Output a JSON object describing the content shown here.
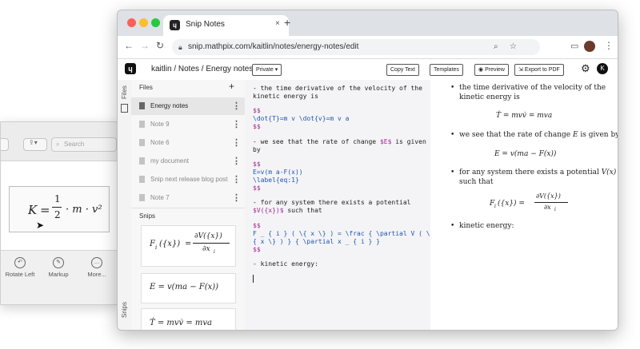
{
  "preview_app": {
    "search_placeholder": "Search",
    "equation": {
      "lhs": "K",
      "eq": "=",
      "num": "1",
      "den": "2",
      "rest": "· m · v²"
    },
    "toolbar": [
      {
        "label": "Rotate Left",
        "icon": "rotate-left-icon"
      },
      {
        "label": "Markup",
        "icon": "markup-icon"
      },
      {
        "label": "More...",
        "icon": "more-icon"
      }
    ]
  },
  "browser": {
    "tab_title": "Snip Notes",
    "new_tab": "+",
    "url": "snip.mathpix.com/kaitlin/notes/energy-notes/edit",
    "avatar": "K"
  },
  "app": {
    "breadcrumb": "kaitlin / Notes / Energy notes",
    "privacy": "Private ▾",
    "buttons": {
      "copy_text": "Copy Text",
      "templates": "Templates",
      "preview": "Preview",
      "export_pdf": "Export to PDF"
    },
    "user_initial": "K"
  },
  "rail": {
    "files_label": "Files",
    "snips_label": "Snips"
  },
  "files": {
    "title": "Files",
    "add": "+",
    "items": [
      {
        "label": "Energy notes",
        "active": true
      },
      {
        "label": "Note 9"
      },
      {
        "label": "Note 6"
      },
      {
        "label": "my document"
      },
      {
        "label": "Snip next release blog post"
      },
      {
        "label": "Note 7"
      }
    ],
    "snips_header": "Snips",
    "snips": [
      {
        "lhs": "F",
        "sub": "i",
        "arg": "({x})",
        "num": "∂V({x})",
        "den": "∂x",
        "densub": "i"
      },
      {
        "text": "E = v(ma − F(x))"
      },
      {
        "text": "Ṫ = mvv̇ = mva"
      }
    ]
  },
  "editor": {
    "l1": "- the time derivative of the velocity of the",
    "l2": "kinetic energy is",
    "l3": "$$",
    "l4": "\\dot{T}=m v \\dot{v}=m v a",
    "l5": "$$",
    "l6a": "- we see that the rate of change ",
    "l6b": "$E$",
    "l6c": " is given",
    "l7": "by",
    "l8": "$$",
    "l9": "E=v(m a-F(x))",
    "l10": "\\label{eq:1}",
    "l11": "$$",
    "l12": "- for any system there exists a potential",
    "l13a": "$V({x})$",
    "l13b": " such that",
    "l14": "$$",
    "l15": "F _ { i } ( \\{ x \\} ) = \\frac { \\partial V ( \\",
    "l16": "{ x \\} ) } { \\partial x _ { i } }",
    "l17": "$$",
    "l18": "- kinetic energy:"
  },
  "preview": {
    "b1a": "the time derivative of the velocity of the",
    "b1b": "kinetic energy is",
    "eq1": "Ṫ = mvv̇ = mva",
    "b2a": "we see that the rate of change ",
    "b2var": "E",
    "b2b": " is given by",
    "eq2": "E = v(ma − F(x))",
    "b3a": "for any system there exists a potential ",
    "b3var": "V(x)",
    "b3b": "such that",
    "eq3_lhs": "F",
    "eq3_sub": "i",
    "eq3_arg": "({x}) =",
    "eq3_num": "∂V({x})",
    "eq3_den": "∂x",
    "eq3_densub": "i",
    "b4": "kinetic energy:"
  }
}
